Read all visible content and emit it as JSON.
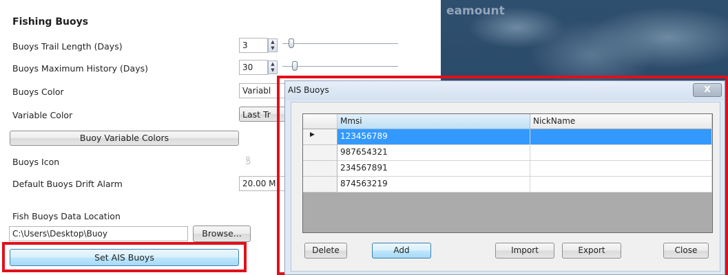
{
  "settings": {
    "section_title": "Fishing Buoys",
    "trail_length_label": "Buoys Trail Length (Days)",
    "trail_length_value": "3",
    "max_history_label": "Buoys Maximum History (Days)",
    "max_history_value": "30",
    "color_label": "Buoys Color",
    "color_value": "Variabl",
    "variable_color_label": "Variable Color",
    "variable_color_value": "Last Tr",
    "variable_colors_button": "Buoy Variable Colors",
    "icon_label": "Buoys Icon",
    "drift_alarm_label": "Default Buoys Drift Alarm",
    "drift_alarm_value": "20.00 M",
    "data_location_label": "Fish Buoys Data Location",
    "data_location_value": "C:\\Users\\Desktop\\Buoy",
    "browse_button": "Browse...",
    "set_ais_button": "Set AIS Buoys"
  },
  "map": {
    "label": "eamount"
  },
  "dialog": {
    "title": "AIS Buoys",
    "close_icon": "X",
    "columns": [
      "Mmsi",
      "NickName"
    ],
    "rows": [
      {
        "mmsi": "123456789",
        "nickname": ""
      },
      {
        "mmsi": "987654321",
        "nickname": ""
      },
      {
        "mmsi": "234567891",
        "nickname": ""
      },
      {
        "mmsi": "874563219",
        "nickname": ""
      }
    ],
    "selected_row": 0,
    "buttons": {
      "delete": "Delete",
      "add": "Add",
      "import": "Import",
      "export": "Export",
      "close": "Close"
    }
  },
  "colors": {
    "highlight_red": "#e0101b",
    "selection_blue": "#3399ff"
  }
}
